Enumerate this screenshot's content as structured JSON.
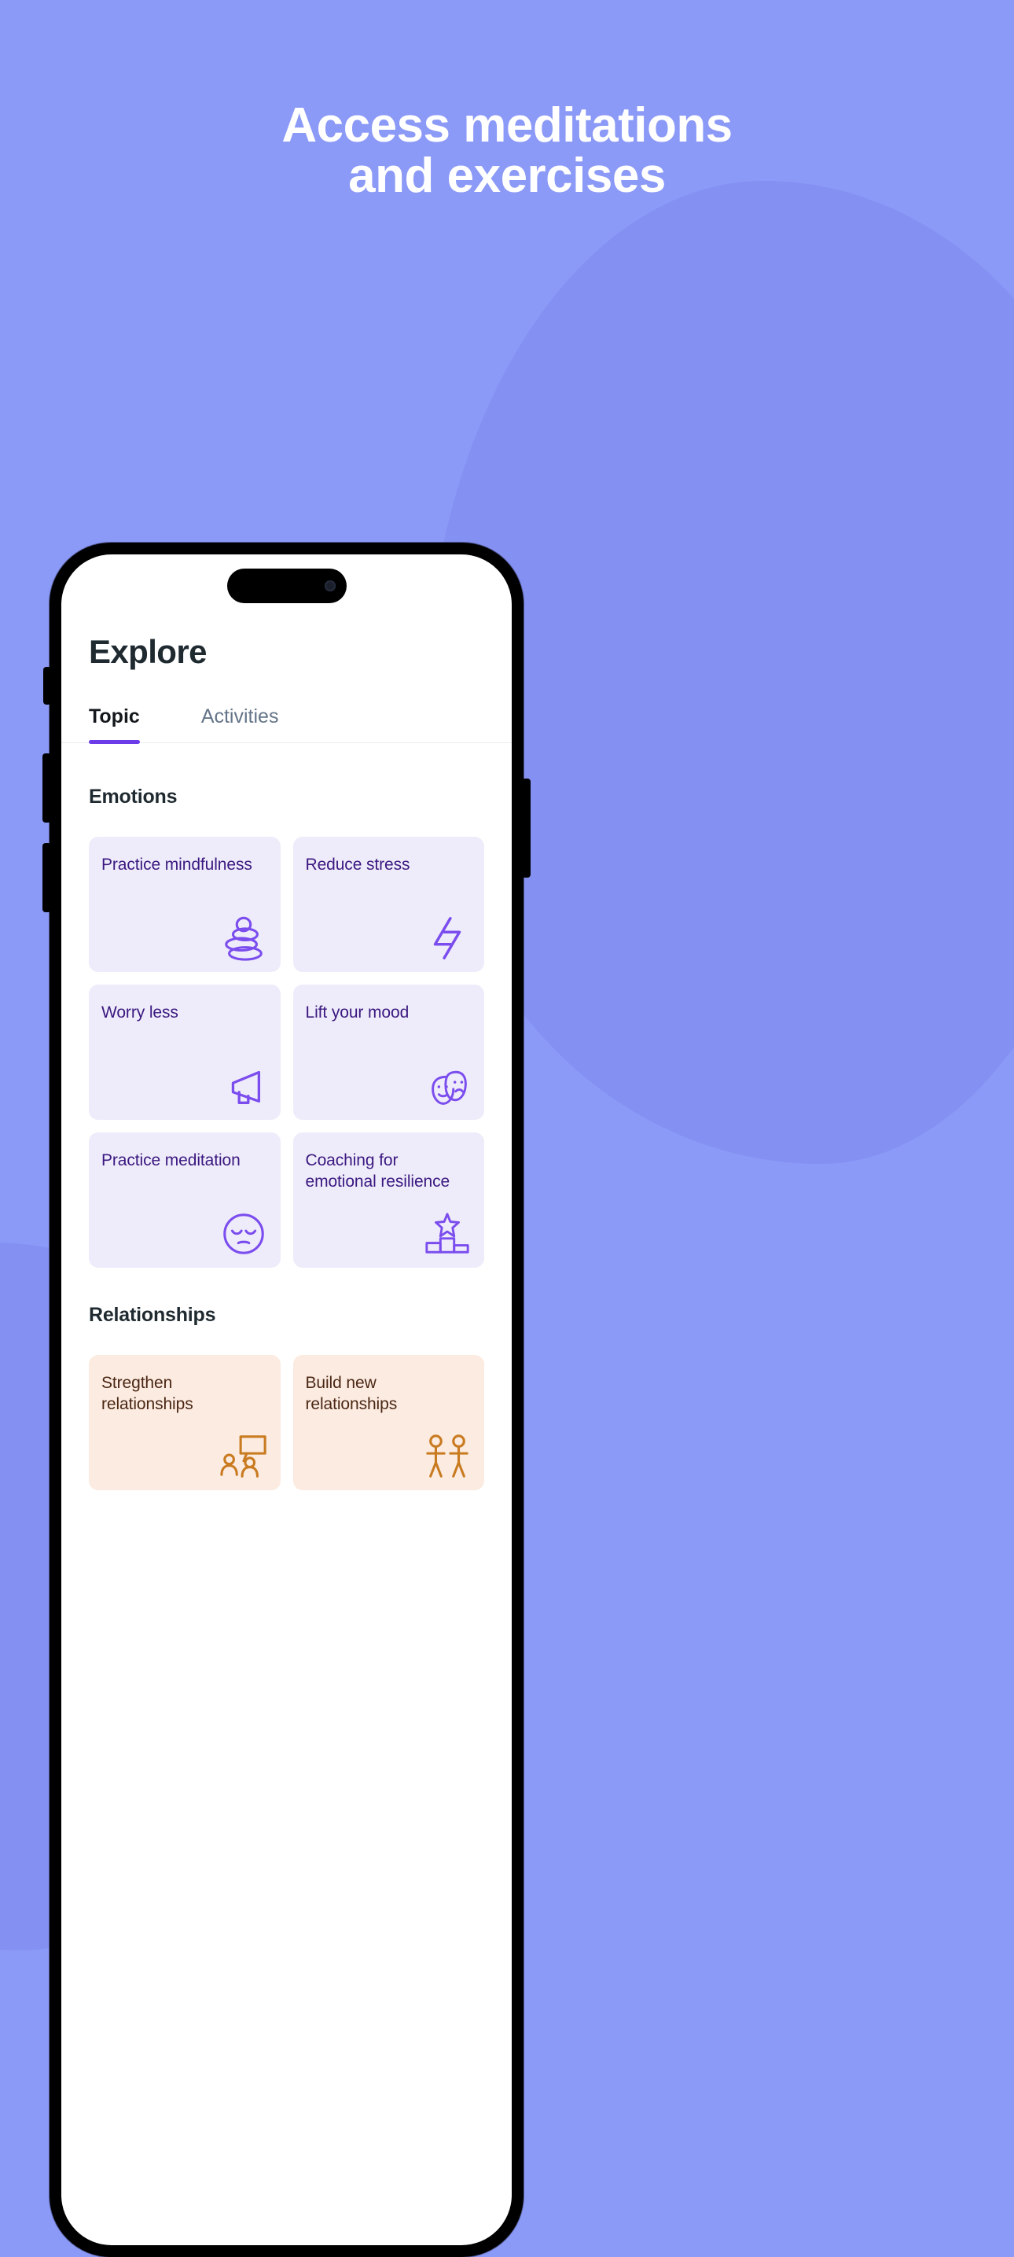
{
  "colors": {
    "page_background": "#8b99f7",
    "headline_text": "#ffffff",
    "accent_purple": "#6c3ce9",
    "icon_purple": "#7b4dee",
    "icon_orange": "#c97b20",
    "card_purple_bg": "#eeecfa",
    "card_purple_text": "#3b1880",
    "card_peach_bg": "#fcebe1",
    "card_peach_text": "#4a2713",
    "title_text": "#1f2a30",
    "tab_inactive_text": "#647489"
  },
  "promo": {
    "headline_line1": "Access meditations",
    "headline_line2": "and exercises"
  },
  "app": {
    "page_title": "Explore",
    "tabs": [
      {
        "label": "Topic",
        "active": true
      },
      {
        "label": "Activities",
        "active": false
      }
    ],
    "sections": [
      {
        "title": "Emotions",
        "theme": "purple",
        "cards": [
          {
            "label": "Practice mindfulness",
            "icon": "stacked-stones-icon"
          },
          {
            "label": "Reduce stress",
            "icon": "lightning-bolt-icon"
          },
          {
            "label": "Worry less",
            "icon": "megaphone-icon"
          },
          {
            "label": "Lift your mood",
            "icon": "theater-masks-icon"
          },
          {
            "label": "Practice meditation",
            "icon": "calm-face-icon"
          },
          {
            "label": "Coaching for emotional resilience",
            "icon": "podium-star-icon"
          }
        ]
      },
      {
        "title": "Relationships",
        "theme": "peach",
        "cards": [
          {
            "label": "Stregthen relationships",
            "icon": "presentation-people-icon"
          },
          {
            "label": "Build new relationships",
            "icon": "two-people-icon"
          }
        ]
      }
    ]
  },
  "device": {
    "dynamic_island": "dynamic-island",
    "camera": "front-camera-dot"
  }
}
